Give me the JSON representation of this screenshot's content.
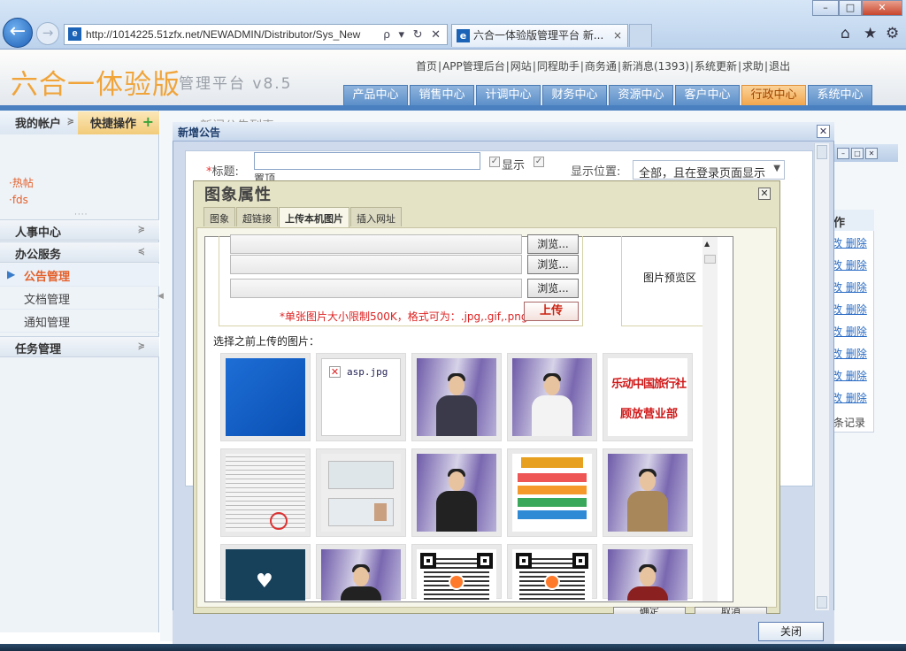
{
  "browser": {
    "url": "http://1014225.51zfx.net/NEWADMIN/Distributor/Sys_New",
    "tab_title": "六合一体验版管理平台 新...",
    "tab_close": "×",
    "addr_buttons": "ρ ▾ ↻ ✕"
  },
  "app": {
    "logo": "六合一体验版",
    "logo_sub": "管理平台 v8.5",
    "top_links": [
      "首页",
      "|",
      "APP管理后台",
      "|",
      "网站",
      "|",
      "同程助手",
      "|",
      "商务通",
      "|",
      "新消息(1393)",
      "|",
      "系统更新",
      "|",
      "求助",
      "|",
      "退出"
    ],
    "nav_tabs": [
      {
        "label": "产品中心"
      },
      {
        "label": "销售中心"
      },
      {
        "label": "计调中心"
      },
      {
        "label": "财务中心"
      },
      {
        "label": "资源中心"
      },
      {
        "label": "客户中心"
      },
      {
        "label": "行政中心",
        "active": true
      },
      {
        "label": "系统中心"
      }
    ]
  },
  "sidebar": {
    "account": "我的帐户",
    "quick": "快捷操作",
    "hot_links": [
      "·热帖",
      "·fds"
    ],
    "more": "····",
    "sections": [
      {
        "label": "人事中心"
      },
      {
        "label": "办公服务",
        "items": [
          "公告管理",
          "文档管理",
          "通知管理"
        ]
      },
      {
        "label": "任务管理"
      }
    ]
  },
  "background_page": {
    "title": "新闻公告列表",
    "col_header": "作",
    "row_action": "改 删除",
    "count": "条记录",
    "cancel": "消"
  },
  "announce_dialog": {
    "title": "新增公告",
    "title_label": "标题:",
    "required_mark": "*",
    "pin_label": "置顶",
    "show_label": "显示",
    "pos_label": "显示位置:",
    "pos_value": "全部，且在登录页面显示",
    "close_button": "关闭"
  },
  "image_dialog": {
    "title": "图象属性",
    "tabs": [
      {
        "label": "图象"
      },
      {
        "label": "超链接"
      },
      {
        "label": "上传本机图片",
        "active": true
      },
      {
        "label": "插入网址"
      }
    ],
    "browse_label": "浏览...",
    "limit_text": "*单张图片大小限制500K，格式可为：.jpg,.gif,.png",
    "upload_label": "上传",
    "preview_label": "图片预览区",
    "previous_label": "选择之前上传的图片：",
    "broken_image_label": "asp.jpg",
    "stamp_line1": "乐动中国旅行社",
    "stamp_line2": "顾放营业部",
    "ok_label": "确定",
    "cancel_label": "取消"
  },
  "colors": {
    "brand_orange": "#f0a43a",
    "nav_blue": "#5c8fc9",
    "active_orange": "#f2a64d",
    "link_red": "#e4602a",
    "dialog_khaki": "#e5e3c6"
  }
}
